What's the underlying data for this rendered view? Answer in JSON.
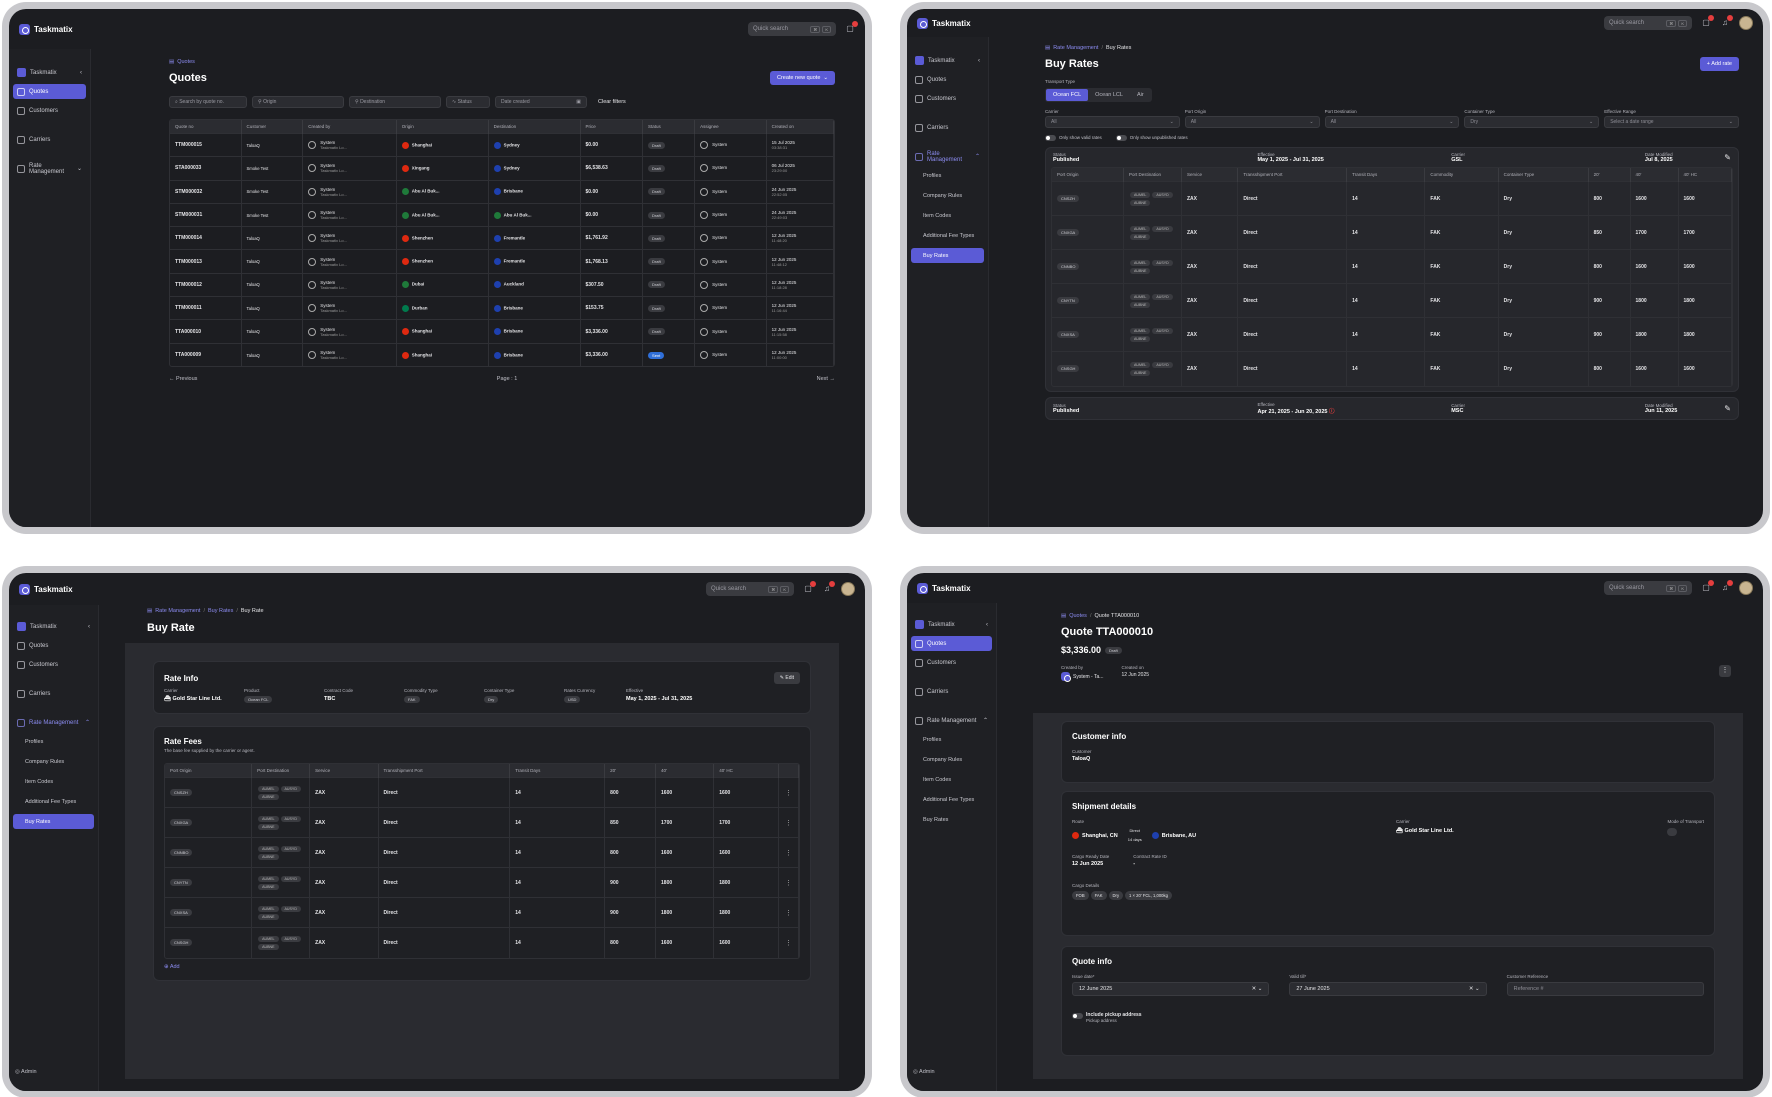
{
  "app": {
    "name": "Taskmatix",
    "quick_search": "Quick search",
    "kbd": [
      "⌘",
      "K"
    ],
    "workspace": "Taskmatix",
    "user": "Admin"
  },
  "nav": {
    "quotes": "Quotes",
    "customers": "Customers",
    "carriers": "Carriers",
    "rate_management": "Rate Management",
    "sub": [
      "Profiles",
      "Company Rules",
      "Item Codes",
      "Additional Fee Types",
      "Buy Rates"
    ]
  },
  "colors": {
    "accent": "#5b5bd6",
    "bg": "#1c1d21"
  },
  "quotes": {
    "crumb": "Quotes",
    "title": "Quotes",
    "create": "Create new quote",
    "filters": {
      "search": "Search by quote no.",
      "origin": "Origin",
      "destination": "Destination",
      "status": "Status",
      "date": "Date created",
      "clear": "Clear filters"
    },
    "headers": [
      "Quote no",
      "Customer",
      "Created by",
      "Origin",
      "Destination",
      "Price",
      "Status",
      "Assignee",
      "Created on"
    ],
    "rows": [
      [
        "TTM000015",
        "TaloaQ",
        "System",
        "Taskmatix Lo...",
        "Shanghai",
        "Sydney",
        "$0.00",
        "Draft",
        "System",
        "15 Jul 2025",
        "03:38:31"
      ],
      [
        "STA000033",
        "Smoke Test",
        "System",
        "Taskmatix Lo...",
        "Xingang",
        "Sydney",
        "$6,538.63",
        "Draft",
        "System",
        "06 Jul 2025",
        "23:29:00"
      ],
      [
        "STM000032",
        "Smoke Test",
        "System",
        "Taskmatix Lo...",
        "Abu Al Buk...",
        "Brisbane",
        "$0.00",
        "Draft",
        "System",
        "24 Jun 2025",
        "22:52:05"
      ],
      [
        "STM000031",
        "Smoke Test",
        "System",
        "Taskmatix Lo...",
        "Abu Al Buk...",
        "Abu Al Buk...",
        "$0.00",
        "Draft",
        "System",
        "24 Jun 2025",
        "22:49:03"
      ],
      [
        "TTM000014",
        "TaloaQ",
        "System",
        "Taskmatix Lo...",
        "Shenzhen",
        "Fremantle",
        "$1,761.92",
        "Draft",
        "System",
        "12 Jun 2025",
        "11:48:20"
      ],
      [
        "TTM000013",
        "TaloaQ",
        "System",
        "Taskmatix Lo...",
        "Shenzhen",
        "Fremantle",
        "$1,768.13",
        "Draft",
        "System",
        "12 Jun 2025",
        "11:48:12"
      ],
      [
        "TTM000012",
        "TaloaQ",
        "System",
        "Taskmatix Lo...",
        "Dubai",
        "Auckland",
        "$307.50",
        "Draft",
        "System",
        "12 Jun 2025",
        "11:18:28"
      ],
      [
        "TTM000011",
        "TaloaQ",
        "System",
        "Taskmatix Lo...",
        "Durban",
        "Brisbane",
        "$153.75",
        "Draft",
        "System",
        "12 Jun 2025",
        "11:16:44"
      ],
      [
        "TTA000010",
        "TaloaQ",
        "System",
        "Taskmatix Lo...",
        "Shanghai",
        "Brisbane",
        "$3,336.00",
        "Draft",
        "System",
        "12 Jun 2025",
        "11:15:58"
      ],
      [
        "TTA000009",
        "TaloaQ",
        "System",
        "Taskmatix Lo...",
        "Shanghai",
        "Brisbane",
        "$3,336.00",
        "Sent",
        "System",
        "12 Jun 2025",
        "11:00:00"
      ]
    ],
    "prev": "← Previous",
    "page": "Page : 1",
    "next": "Next →"
  },
  "buyrates": {
    "crumb_parent": "Rate Management",
    "crumb_cur": "Buy Rates",
    "title": "Buy Rates",
    "add": "+ Add rate",
    "transport_label": "Transport Type",
    "transport": [
      "Ocean FCL",
      "Ocean LCL",
      "Air"
    ],
    "filter_labels": [
      "Carrier",
      "Port Origin",
      "Port Destination",
      "Container Type",
      "Effective Range"
    ],
    "filter_values": [
      "All",
      "All",
      "All",
      "Dry",
      "Select a date range"
    ],
    "toggle_valid": "Only show valid rates",
    "toggle_unpub": "Only show unpublished rates",
    "card1": {
      "status_l": "Status",
      "status": "Published",
      "eff_l": "Effective",
      "eff": "May 1, 2025 - Jul 31, 2025",
      "carrier_l": "Carrier",
      "carrier": "GSL",
      "mod_l": "Date Modified",
      "mod": "Jul 8, 2025"
    },
    "card2": {
      "status_l": "Status",
      "status": "Published",
      "eff_l": "Effective",
      "eff": "Apr 21, 2025 - Jun 20, 2025",
      "carrier_l": "Carrier",
      "carrier": "MSC",
      "mod_l": "Date Modified",
      "mod": "Jun 11, 2025"
    },
    "headers": [
      "Port Origin",
      "Port Destination",
      "Service",
      "Transshipment Port",
      "Transit Days",
      "Commodity",
      "Container Type",
      "20'",
      "40'",
      "40' HC"
    ],
    "rows": [
      [
        "CNSZH",
        "ZAX",
        "Direct",
        "14",
        "FAK",
        "Dry",
        "800",
        "1600",
        "1600"
      ],
      [
        "CNXGA",
        "ZAX",
        "Direct",
        "14",
        "FAK",
        "Dry",
        "850",
        "1700",
        "1700"
      ],
      [
        "CNNBO",
        "ZAX",
        "Direct",
        "14",
        "FAK",
        "Dry",
        "800",
        "1600",
        "1600"
      ],
      [
        "CNYTN",
        "ZAX",
        "Direct",
        "14",
        "FAK",
        "Dry",
        "900",
        "1800",
        "1800"
      ],
      [
        "CNXSA",
        "ZAX",
        "Direct",
        "14",
        "FAK",
        "Dry",
        "900",
        "1800",
        "1800"
      ],
      [
        "CNSGH",
        "ZAX",
        "Direct",
        "14",
        "FAK",
        "Dry",
        "800",
        "1600",
        "1600"
      ]
    ],
    "dest_tags": [
      "AUMEL",
      "AUSYD",
      "AUBNE"
    ]
  },
  "buyrate": {
    "crumb": [
      "Rate Management",
      "Buy Rates",
      "Buy Rate"
    ],
    "title": "Buy Rate",
    "info_title": "Rate Info",
    "edit": "Edit",
    "fields": [
      {
        "label": "Carrier",
        "value": "Gold Star Line Ltd."
      },
      {
        "label": "Product",
        "value": "Ocean FCL"
      },
      {
        "label": "Contract Code",
        "value": "TBC"
      },
      {
        "label": "Commodity Type",
        "value": "FAK"
      },
      {
        "label": "Container Type",
        "value": "Dry"
      },
      {
        "label": "Rates Currency",
        "value": "USD"
      },
      {
        "label": "Effective",
        "value": "May 1, 2025 - Jul 31, 2025"
      }
    ],
    "fees_title": "Rate Fees",
    "fees_sub": "The base fee supplied by the carrier or agent.",
    "headers": [
      "Port Origin",
      "Port Destination",
      "Service",
      "Transshipment Port",
      "Transit Days",
      "20'",
      "40'",
      "40' HC"
    ],
    "add": "⊕ Add"
  },
  "quote": {
    "crumb": [
      "Quotes",
      "Quote TTA000010"
    ],
    "title": "Quote TTA000010",
    "price": "$3,336.00",
    "status": "Draft",
    "created_by_l": "Created by",
    "created_by": "System - Ta...",
    "created_on_l": "Created on",
    "created_on": "12 Jun 2025",
    "cust_title": "Customer info",
    "cust_l": "Customer",
    "cust": "TaloaQ",
    "ship_title": "Shipment details",
    "route_l": "Route",
    "origin": "Shanghai, CN",
    "direct": "Direct",
    "days": "14 days",
    "dest": "Brisbane, AU",
    "carrier_l": "Carrier",
    "carrier": "Gold Star Line Ltd.",
    "mode_l": "Mode of Transport",
    "ready_l": "Cargo Ready Date",
    "ready": "12 Jun 2025",
    "contract_l": "Contract Rate ID",
    "contract": "-",
    "cargo_l": "Cargo Details",
    "cargo": [
      "FOB",
      "FAK",
      "Dry",
      "1 × 20' FCL, 1,000kg"
    ],
    "qi_title": "Quote info",
    "issue_l": "Issue date*",
    "issue": "12 June 2025",
    "valid_l": "Valid till*",
    "valid": "27 June 2025",
    "ref_l": "Customer Reference",
    "ref_ph": "Reference #",
    "pickup": "Include pickup address",
    "pickup_sub": "Pickup address"
  }
}
